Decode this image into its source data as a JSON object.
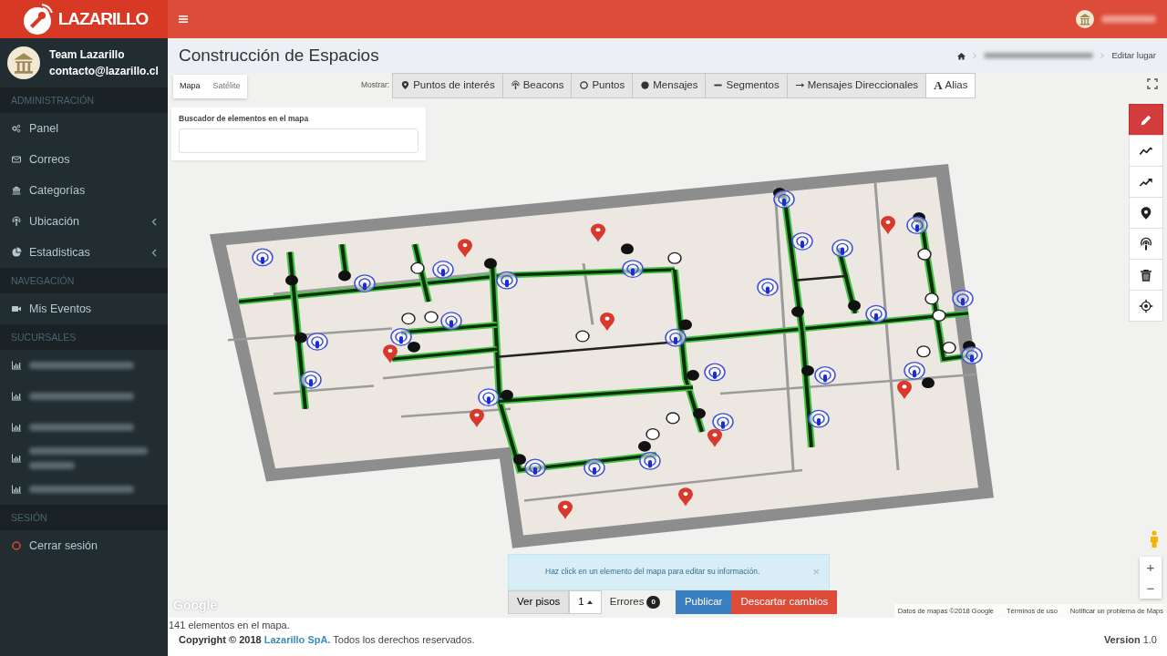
{
  "brand": {
    "name": "LAZARILLO"
  },
  "user": {
    "name": "Team Lazarillo",
    "email": "contacto@lazarillo.cl"
  },
  "sidebar": {
    "sections": [
      {
        "header": "ADMINISTRACIÓN",
        "items": [
          {
            "label": "Panel",
            "kind": "gears",
            "submenu": false,
            "blurred": false
          },
          {
            "label": "Correos",
            "kind": "envelope",
            "submenu": false,
            "blurred": false
          },
          {
            "label": "Categorías",
            "kind": "bank",
            "submenu": false,
            "blurred": false
          },
          {
            "label": "Ubicación",
            "kind": "beacon",
            "submenu": true,
            "blurred": false
          },
          {
            "label": "Estadisticas",
            "kind": "pie-chart",
            "submenu": true,
            "blurred": false
          }
        ]
      },
      {
        "header": "NAVEGACIÓN",
        "items": [
          {
            "label": "Mis Eventos",
            "kind": "video-camera",
            "submenu": false,
            "blurred": false
          }
        ]
      },
      {
        "header": "SUCURSALES",
        "items": [
          {
            "kind": "bar-chart",
            "submenu": false,
            "blurred": true,
            "wrapped": false
          },
          {
            "kind": "bar-chart",
            "submenu": false,
            "blurred": true,
            "wrapped": false
          },
          {
            "kind": "bar-chart",
            "submenu": false,
            "blurred": true,
            "wrapped": false
          },
          {
            "kind": "bar-chart",
            "submenu": false,
            "blurred": true,
            "wrapped": true
          },
          {
            "kind": "bar-chart",
            "submenu": false,
            "blurred": true,
            "wrapped": false
          }
        ]
      },
      {
        "header": "SESIÓN",
        "items": [
          {
            "label": "Cerrar sesión",
            "kind": "circle-outline",
            "submenu": false,
            "blurred": false
          }
        ]
      }
    ]
  },
  "page": {
    "title": "Construcción de Espacios",
    "breadcrumb": [
      {
        "kind": "home"
      },
      {
        "kind": "blurred"
      },
      {
        "kind": "text",
        "label": "Editar lugar"
      }
    ]
  },
  "map_type": [
    {
      "label": "Mapa",
      "selected": true
    },
    {
      "label": "Satélite",
      "selected": false
    }
  ],
  "show_label": "Mostrar:",
  "layers": [
    {
      "label": "Puntos de interés",
      "kind": "map-pin",
      "selected": true
    },
    {
      "label": "Beacons",
      "kind": "beacon",
      "selected": true
    },
    {
      "label": "Puntos",
      "kind": "circle-outline",
      "selected": true
    },
    {
      "label": "Mensajes",
      "kind": "circle-filled",
      "selected": true
    },
    {
      "label": "Segmentos",
      "kind": "dash",
      "selected": true
    },
    {
      "label": "Mensajes Direccionales",
      "kind": "arrow-right",
      "selected": true
    },
    {
      "label": "Alias",
      "kind": "glyph",
      "glyph": "A",
      "selected": false
    }
  ],
  "search": {
    "label": "Buscador de elementos en el mapa"
  },
  "tools": [
    {
      "kind": "pencil",
      "selected": true
    },
    {
      "kind": "line-chart",
      "selected": false
    },
    {
      "kind": "trend-arrow",
      "selected": false
    },
    {
      "kind": "map-pin",
      "selected": false
    },
    {
      "kind": "beacon",
      "selected": false
    },
    {
      "kind": "trash",
      "selected": false
    },
    {
      "kind": "crosshair",
      "selected": false
    }
  ],
  "alert": {
    "text": "Haz click en un elemento del mapa para editar su información.",
    "close": "×"
  },
  "bottom": {
    "floors": "Ver pisos",
    "floor": "1",
    "errors_label": "Errores",
    "errors": "0",
    "publish": "Publicar",
    "discard": "Descartar cambios"
  },
  "zoom": [
    "+",
    "−"
  ],
  "map_footer": {
    "logo": "Google",
    "data": "Datos de mapas ©2018 Google",
    "terms": "Términos de uso",
    "report": "Notificar un problema de Maps"
  },
  "status": "141 elementos en el mapa.",
  "footer": {
    "prefix": "Copyright © 2018",
    "link": "Lazarillo SpA.",
    "suffix": "Todos los derechos reservados.",
    "version": "**Version** 1.0"
  }
}
